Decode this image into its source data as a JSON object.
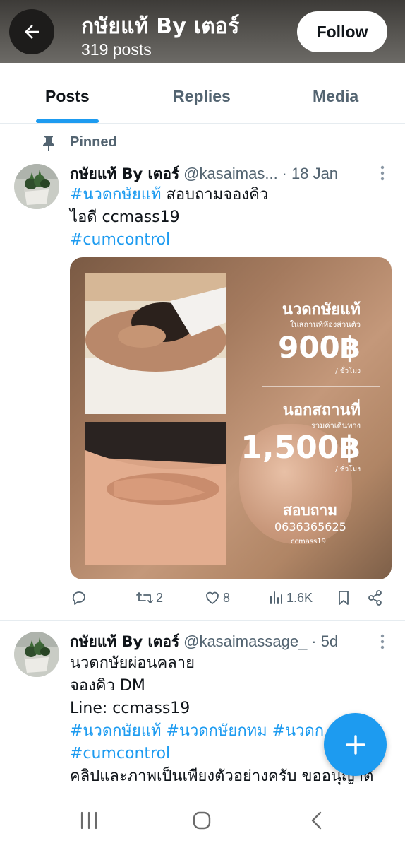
{
  "header": {
    "title": "กษัยแท้ By เตอร์",
    "subtitle": "319 posts",
    "follow_label": "Follow"
  },
  "tabs": [
    {
      "label": "Posts",
      "active": true
    },
    {
      "label": "Replies",
      "active": false
    },
    {
      "label": "Media",
      "active": false
    }
  ],
  "pinned_label": "Pinned",
  "tweets": [
    {
      "name": "กษัยแท้ By เตอร์",
      "handle": "@kasaimas...",
      "time": "· 18 Jan",
      "lines": [
        {
          "hashtag": "#นวดกษัยแท้",
          "text": " สอบถามจองคิว"
        },
        {
          "text": "ไอดี  ccmass19"
        },
        {
          "hashtag": "#cumcontrol"
        }
      ],
      "media_text": {
        "heading1": "นวดกษัยแท้",
        "sub1": "ในสถานที่ห้องส่วนตัว",
        "price1": "900฿",
        "unit1": "/ ชั่วโมง",
        "heading2": "นอกสถานที่",
        "sub2": "รวมค่าเดินทาง",
        "price2": "1,500฿",
        "unit2": "/ ชั่วโมง",
        "contact_heading": "สอบถาม",
        "phone": "0636365625",
        "line_id": "ccmass19"
      },
      "stats": {
        "retweets": "2",
        "likes": "8",
        "views": "1.6K"
      }
    },
    {
      "name": "กษัยแท้ By เตอร์",
      "handle": "@kasaimassage_",
      "time": "· 5d",
      "lines": [
        {
          "text": "นวดกษัยผ่อนคลาย"
        },
        {
          "text": "จองคิว DM"
        },
        {
          "text": "Line: ccmass19"
        },
        {
          "hashtag": "#นวดกษัยแท้ #นวดกษัยกทม #นวดก"
        },
        {
          "hashtag": "#cumcontrol"
        },
        {
          "text": "คลิปและภาพเป็นเพียงตัวอย่างครับ ขออนุญาติ"
        }
      ]
    }
  ],
  "colors": {
    "accent": "#1d9bf0",
    "header_bg": "#4a4845",
    "muted": "#536471"
  }
}
